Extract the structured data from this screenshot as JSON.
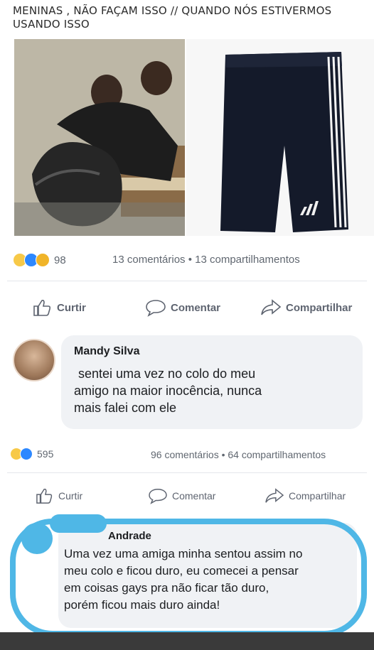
{
  "post1": {
    "caption": "MENINAS , NÃO FAÇAM ISSO // QUANDO NÓS ESTIVERMOS USANDO  ISSO",
    "reaction_count": "98",
    "stats": "13 comentários • 13 compartilhamentos",
    "actions": {
      "like": "Curtir",
      "comment": "Comentar",
      "share": "Compartilhar"
    }
  },
  "comment1": {
    "author": "Mandy Silva",
    "text_lines": [
      "sentei uma vez no colo do meu",
      "amigo na maior inocência, nunca",
      "mais falei com ele"
    ]
  },
  "post2": {
    "reaction_count": "595",
    "stats": "96 comentários • 64 compartilhamentos",
    "actions": {
      "like": "Curtir",
      "comment": "Comentar",
      "share": "Compartilhar"
    }
  },
  "comment2": {
    "author": "Andrade",
    "text_lines": [
      "Uma vez uma amiga minha sentou assim no",
      "meu colo e ficou duro, eu comecei a pensar",
      "em coisas gays pra não ficar tão duro,",
      "porém ficou mais duro ainda!"
    ]
  },
  "colors": {
    "highlight": "#4fb7e6",
    "like_blue": "#2d88ff",
    "bubble": "#f0f2f5"
  },
  "icons": [
    "haha-reaction-icon",
    "like-reaction-icon",
    "sad-reaction-icon",
    "thumbs-up-icon",
    "comment-icon",
    "share-icon"
  ]
}
